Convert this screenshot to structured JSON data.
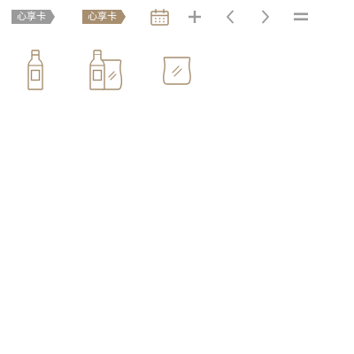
{
  "tags": {
    "card_inactive": "心享卡",
    "card_active": "心享卡"
  },
  "colors": {
    "tag_inactive": "#9a9a9a",
    "tag_active": "#a68e6f",
    "icon_gold": "#a68e6f",
    "icon_grey": "#9a9a9a"
  },
  "toolbar": {
    "icons": [
      "calendar-icon",
      "plus-icon",
      "chevron-left-icon",
      "chevron-right-icon",
      "equals-icon"
    ]
  },
  "products": {
    "icons": [
      "bottle-icon",
      "bottle-and-bag-icon",
      "bag-icon"
    ]
  }
}
